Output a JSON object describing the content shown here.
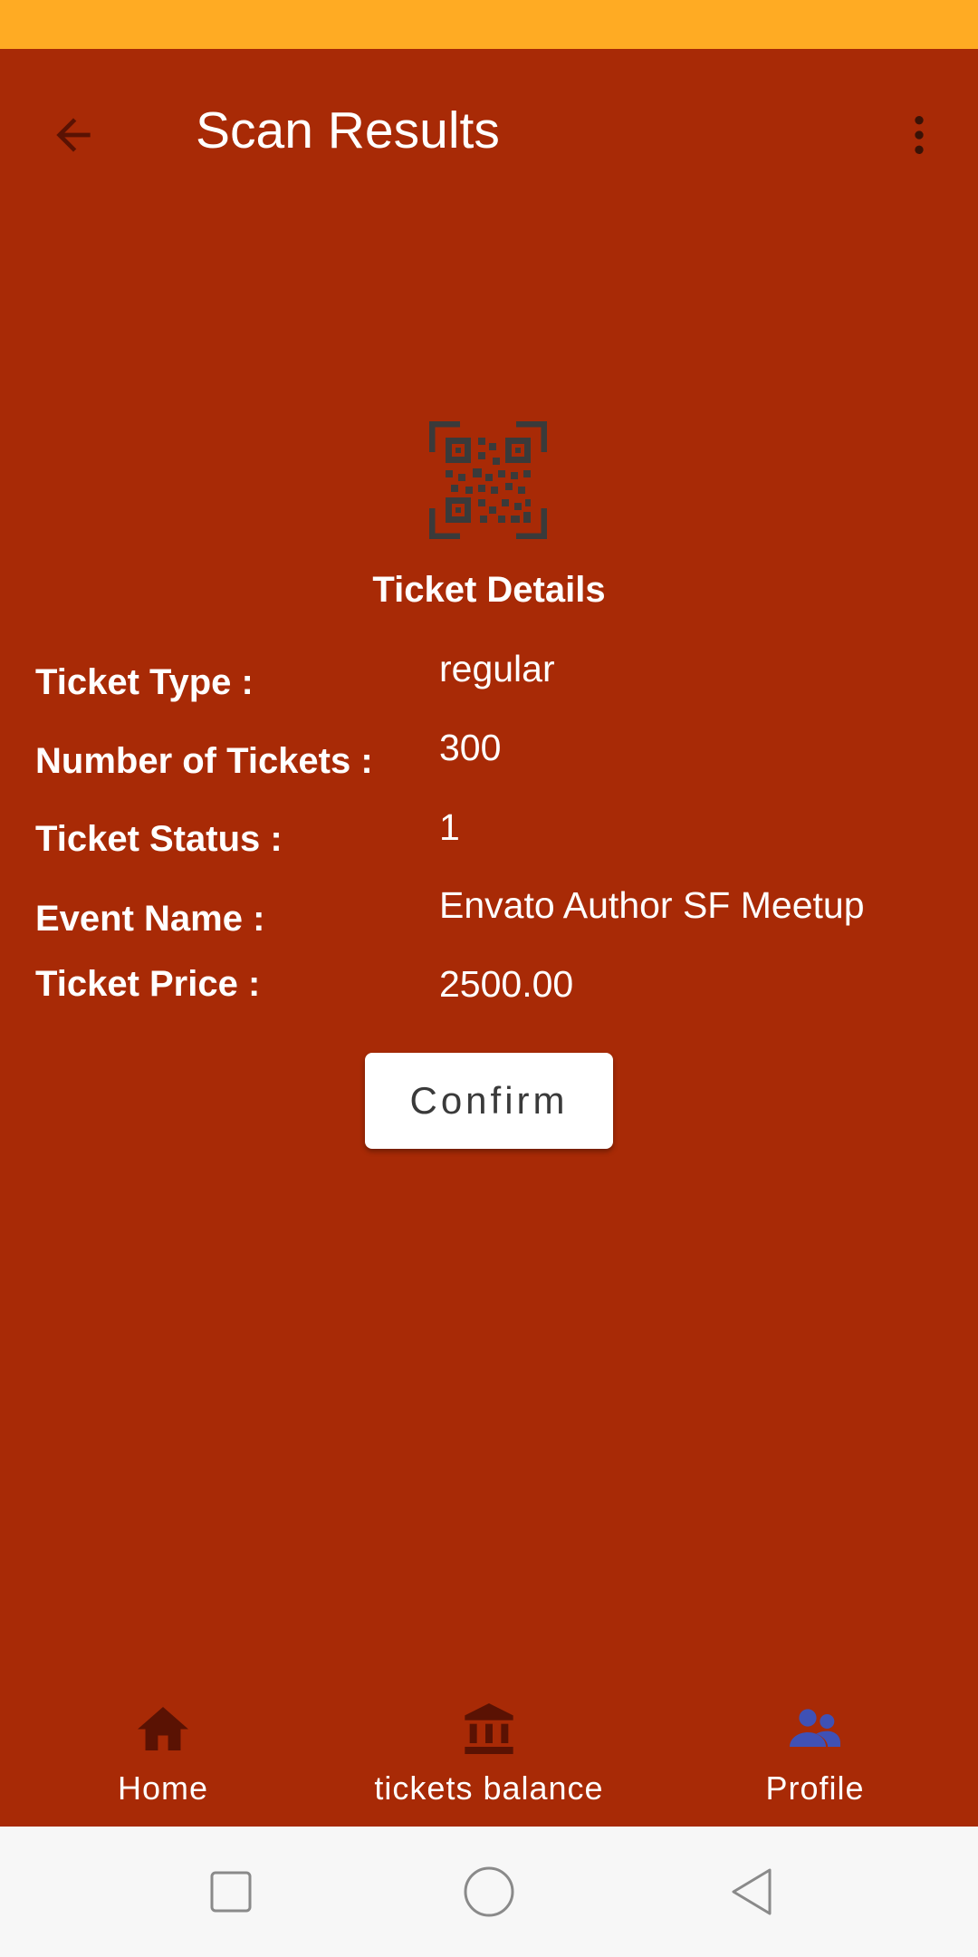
{
  "header": {
    "title": "Scan Results",
    "back_icon": "arrow-back-icon",
    "menu_icon": "more-vert-icon"
  },
  "ticket": {
    "section_title": "Ticket Details",
    "icon": "qr-code-icon",
    "fields": [
      {
        "label": "Ticket Type :",
        "value": "regular"
      },
      {
        "label": "Number of Tickets :",
        "value": "300"
      },
      {
        "label": "Ticket Status :",
        "value": "1"
      },
      {
        "label": "Event Name :",
        "value": "Envato Author SF Meetup"
      },
      {
        "label": "Ticket Price :",
        "value": "2500.00"
      }
    ]
  },
  "actions": {
    "confirm_label": "Confirm"
  },
  "bottom_nav": {
    "items": [
      {
        "label": "Home",
        "icon": "home-icon",
        "active": false
      },
      {
        "label": "tickets balance",
        "icon": "bank-icon",
        "active": false
      },
      {
        "label": "Profile",
        "icon": "people-icon",
        "active": true
      }
    ]
  },
  "system_nav": {
    "recents_icon": "square-icon",
    "home_icon": "circle-icon",
    "back_icon": "triangle-back-icon"
  },
  "colors": {
    "status_bar": "#FFAB23",
    "background": "#A82A06",
    "icon_dark": "#5A1203",
    "active_nav_icon": "#3F51B5",
    "system_nav_bg": "#F7F7F7"
  }
}
